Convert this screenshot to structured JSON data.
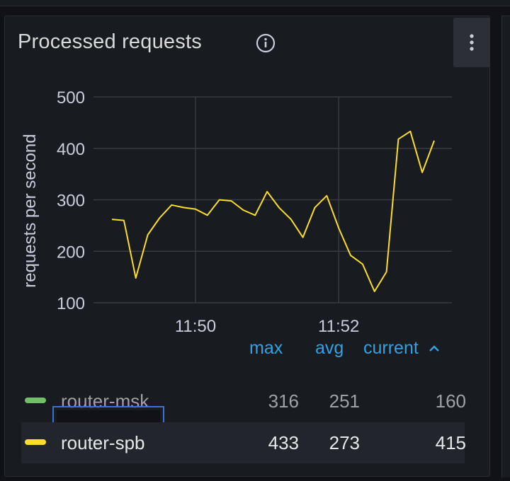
{
  "panel": {
    "title": "Processed requests",
    "info_icon": "info-icon",
    "menu_icon": "vertical-dots-icon"
  },
  "chart_data": {
    "type": "line",
    "title": "Processed requests",
    "xlabel": "",
    "ylabel": "requests per second",
    "ylim": [
      100,
      500
    ],
    "yticks": [
      100,
      200,
      300,
      400,
      500
    ],
    "xticks": [
      "11:50",
      "11:52"
    ],
    "grid": true,
    "x_start": "11:48:50",
    "x_step_seconds": 10,
    "series": [
      {
        "name": "router-spb",
        "color": "#fade2a",
        "values": [
          262,
          260,
          148,
          232,
          265,
          290,
          285,
          282,
          270,
          300,
          298,
          280,
          270,
          316,
          285,
          262,
          227,
          285,
          308,
          245,
          192,
          175,
          122,
          160,
          418,
          433,
          353,
          415
        ]
      }
    ]
  },
  "legend": {
    "headers": {
      "max": "max",
      "avg": "avg",
      "current": "current",
      "sort_icon": "chevron-up-icon"
    },
    "rows": [
      {
        "name": "router-msk",
        "color": "#73bf69",
        "max": "316",
        "avg": "251",
        "current": "160"
      },
      {
        "name": "router-spb",
        "color": "#fade2a",
        "max": "433",
        "avg": "273",
        "current": "415"
      }
    ]
  }
}
